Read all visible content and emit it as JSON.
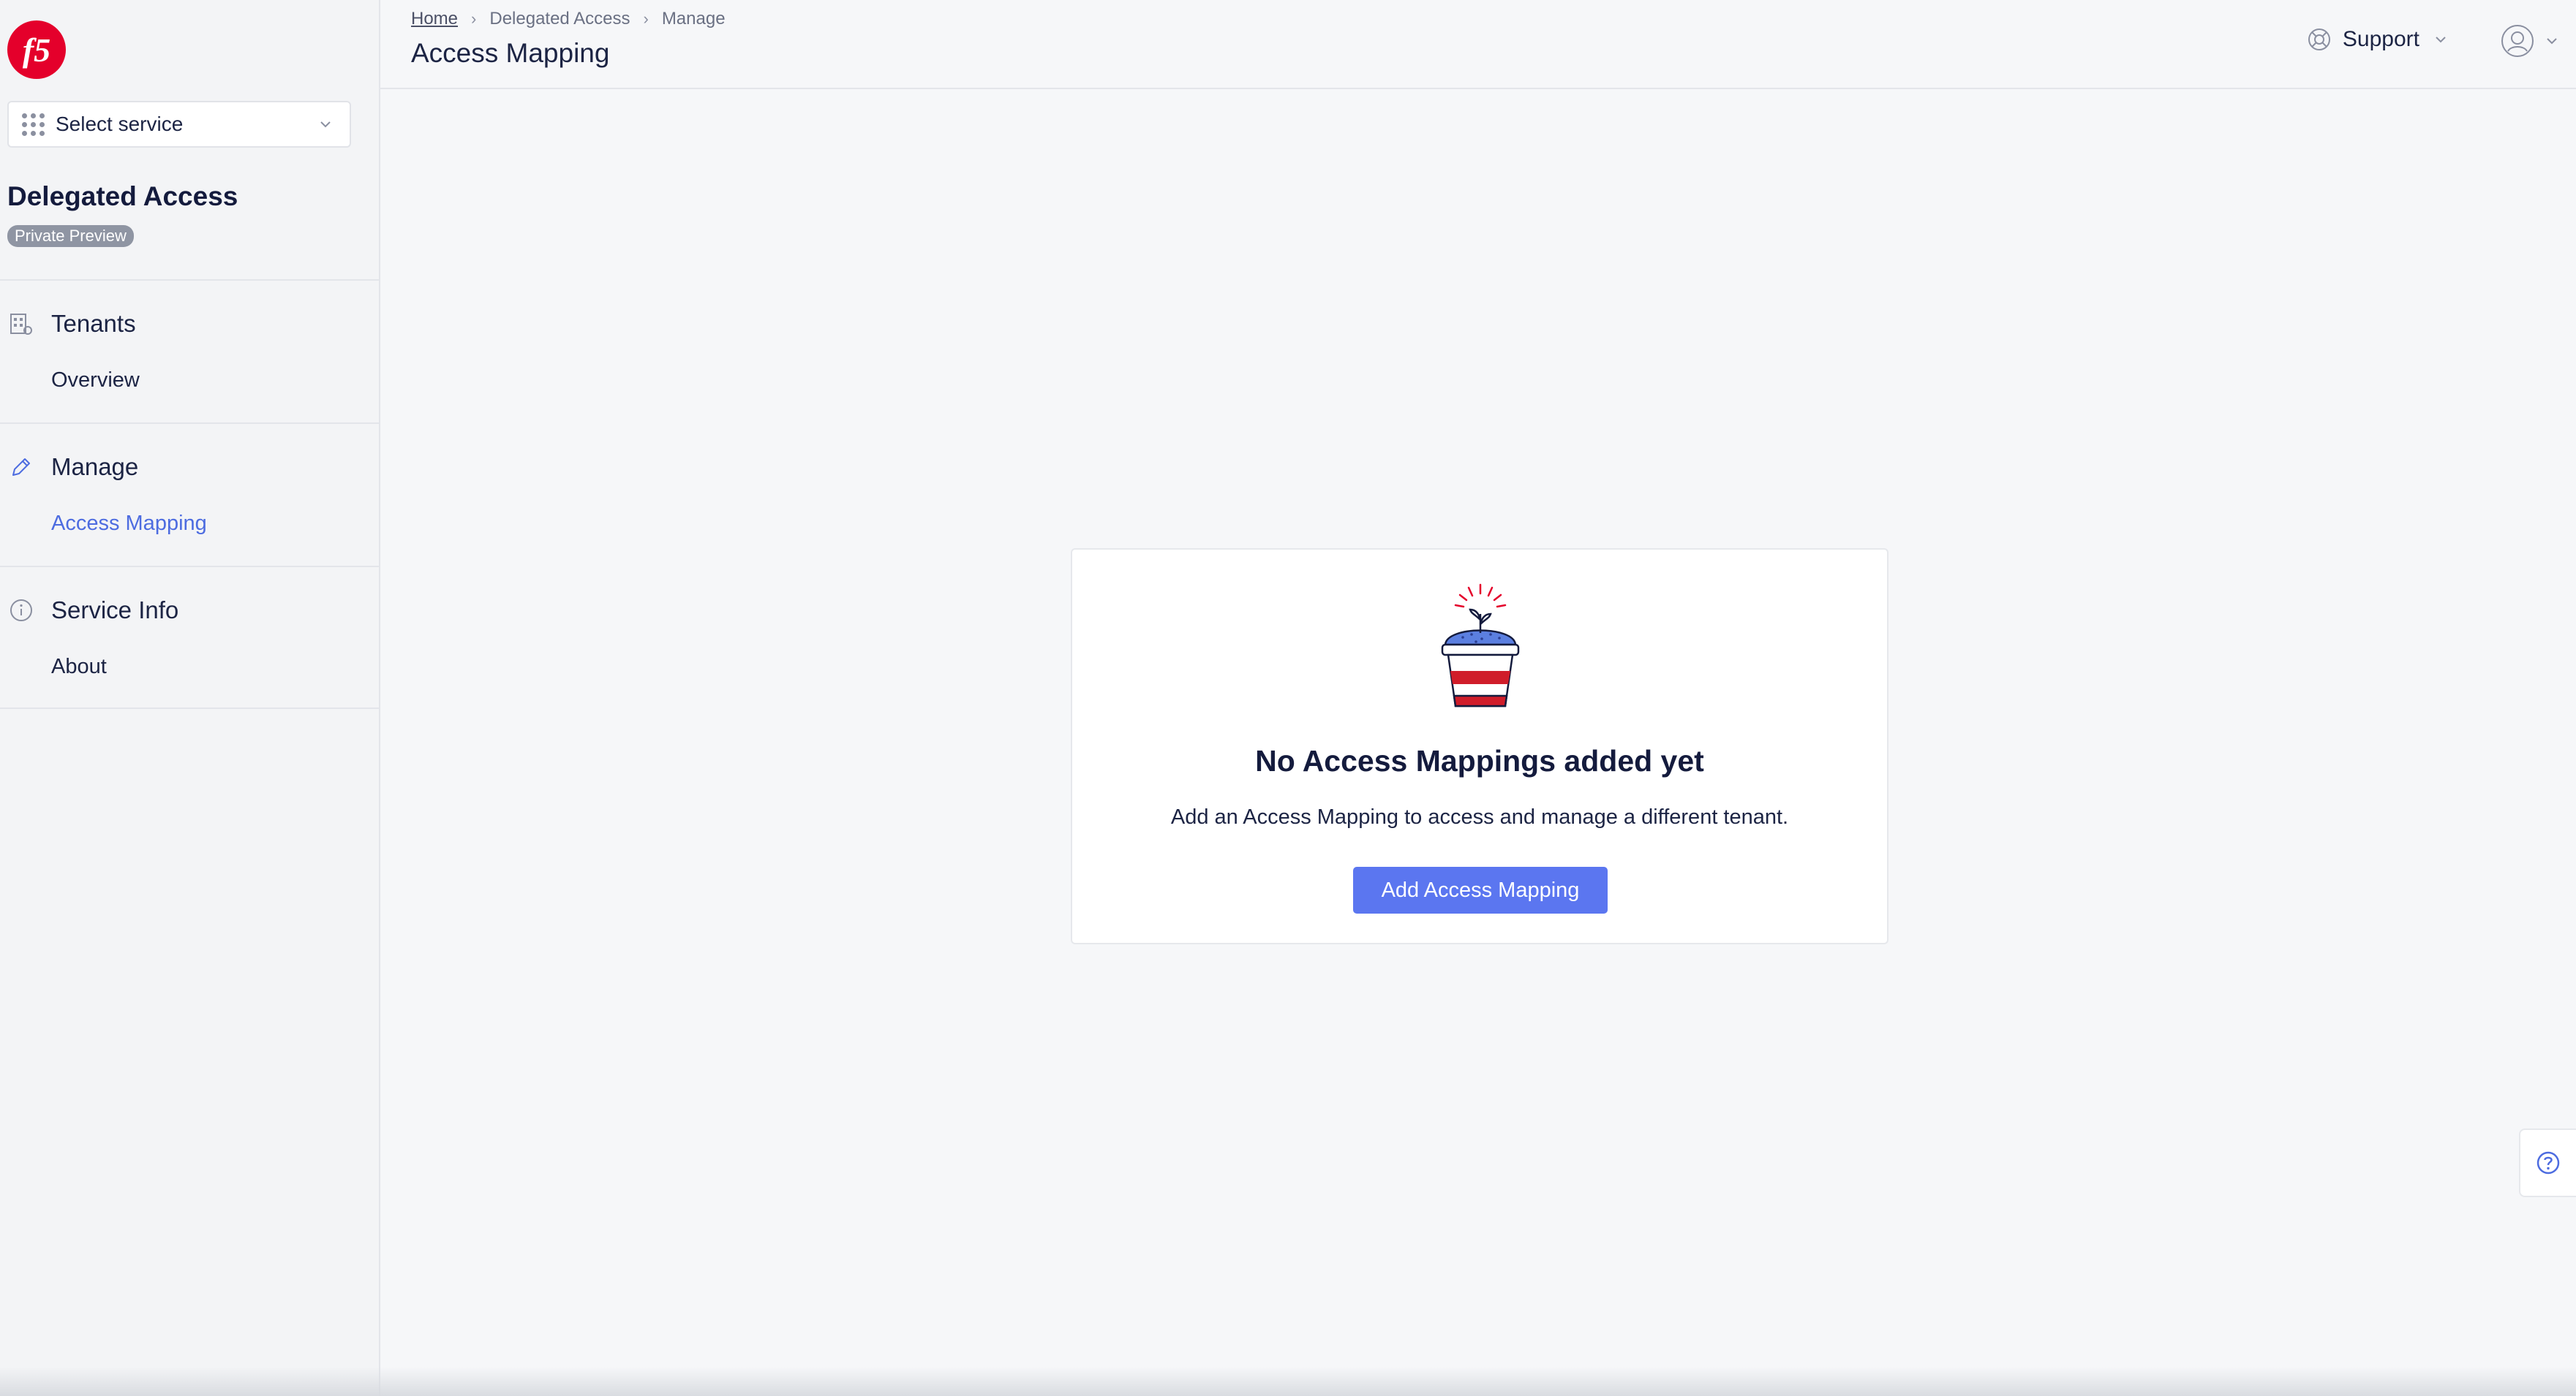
{
  "logo": {
    "text": "f5",
    "color": "#e4002b"
  },
  "service_select": {
    "label": "Select service",
    "icon": "grid-icon"
  },
  "app": {
    "title": "Delegated Access",
    "badge": "Private Preview"
  },
  "nav": [
    {
      "label": "Tenants",
      "icon": "building-icon",
      "items": [
        {
          "label": "Overview",
          "active": false
        }
      ]
    },
    {
      "label": "Manage",
      "icon": "pencil-icon",
      "items": [
        {
          "label": "Access Mapping",
          "active": true
        }
      ]
    },
    {
      "label": "Service Info",
      "icon": "info-icon",
      "items": [
        {
          "label": "About",
          "active": false
        }
      ]
    }
  ],
  "header": {
    "breadcrumb": [
      "Home",
      "Delegated Access",
      "Manage"
    ],
    "title": "Access Mapping",
    "support_label": "Support"
  },
  "empty_state": {
    "title": "No Access Mappings added yet",
    "description": "Add an Access Mapping to access and manage a different tenant.",
    "button_label": "Add Access Mapping"
  },
  "colors": {
    "accent": "#5b76f0",
    "active_link": "#4d6ce0",
    "brand_red": "#e4002b"
  }
}
